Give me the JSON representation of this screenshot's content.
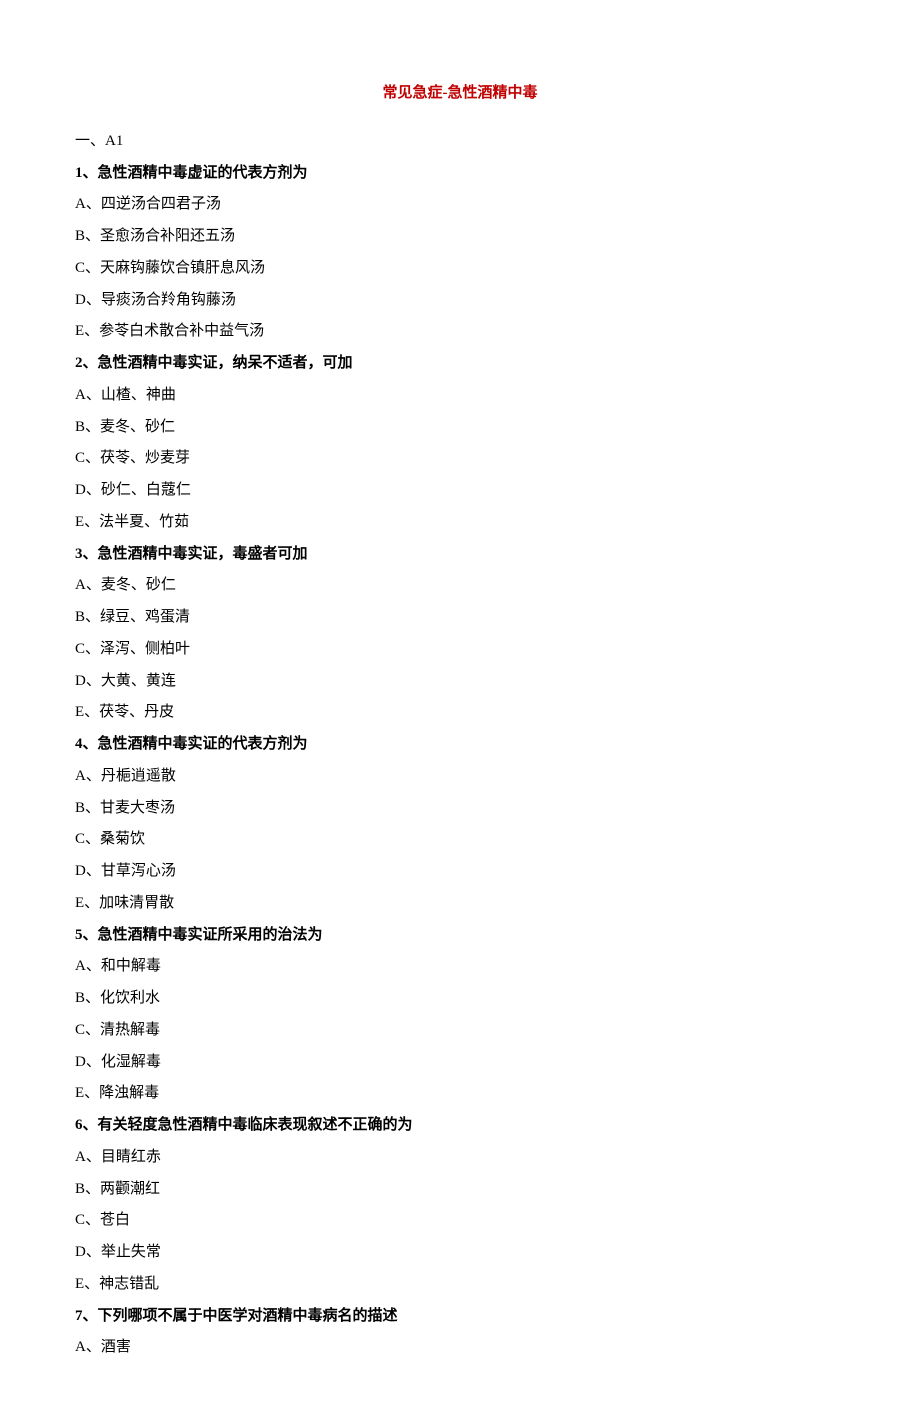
{
  "title": "常见急症-急性酒精中毒",
  "section_label": "一、A1",
  "questions": [
    {
      "number": "1",
      "stem": "急性酒精中毒虚证的代表方剂为",
      "options": [
        "A、四逆汤合四君子汤",
        "B、圣愈汤合补阳还五汤",
        "C、天麻钩藤饮合镇肝息风汤",
        "D、导痰汤合羚角钩藤汤",
        "E、参苓白术散合补中益气汤"
      ]
    },
    {
      "number": "2",
      "stem": "急性酒精中毒实证，纳呆不适者，可加",
      "options": [
        "A、山楂、神曲",
        "B、麦冬、砂仁",
        "C、茯苓、炒麦芽",
        "D、砂仁、白蔻仁",
        "E、法半夏、竹茹"
      ]
    },
    {
      "number": "3",
      "stem": "急性酒精中毒实证，毒盛者可加",
      "options": [
        "A、麦冬、砂仁",
        "B、绿豆、鸡蛋清",
        "C、泽泻、侧柏叶",
        "D、大黄、黄连",
        "E、茯苓、丹皮"
      ]
    },
    {
      "number": "4",
      "stem": "急性酒精中毒实证的代表方剂为",
      "options": [
        "A、丹梔逍遥散",
        "B、甘麦大枣汤",
        "C、桑菊饮",
        "D、甘草泻心汤",
        "E、加味清胃散"
      ]
    },
    {
      "number": "5",
      "stem": "急性酒精中毒实证所采用的治法为",
      "options": [
        "A、和中解毒",
        "B、化饮利水",
        "C、清热解毒",
        "D、化湿解毒",
        "E、降浊解毒"
      ]
    },
    {
      "number": "6",
      "stem": "有关轻度急性酒精中毒临床表现叙述不正确的为",
      "options": [
        "A、目睛红赤",
        "B、两颧潮红",
        "C、苍白",
        "D、举止失常",
        "E、神志错乱"
      ]
    },
    {
      "number": "7",
      "stem": "下列哪项不属于中医学对酒精中毒病名的描述",
      "options": [
        "A、酒害"
      ]
    }
  ]
}
